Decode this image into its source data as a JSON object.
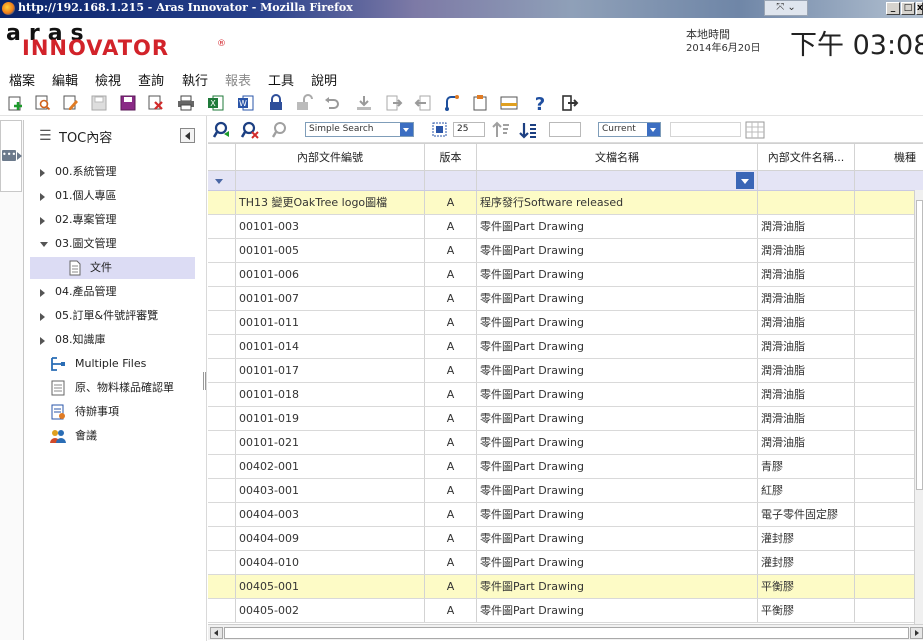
{
  "window": {
    "title": "http://192.168.1.215 - Aras Innovator - Mozilla Firefox"
  },
  "header": {
    "logo_top": "aras",
    "logo_bottom": "INNOVATOR",
    "logo_mark": "®",
    "time_label": "本地時間",
    "date": "2014年6月20日",
    "clock": "下午 03:08"
  },
  "menu": [
    "檔案",
    "編輯",
    "檢視",
    "查詢",
    "執行",
    "報表",
    "工具",
    "說明"
  ],
  "toc": {
    "title": "TOC內容",
    "items": [
      {
        "label": "00.系統管理",
        "state": "collapsed"
      },
      {
        "label": "01.個人專區",
        "state": "collapsed"
      },
      {
        "label": "02.專案管理",
        "state": "collapsed"
      },
      {
        "label": "03.圖文管理",
        "state": "expanded"
      },
      {
        "label": "文件",
        "state": "selected",
        "icon": "document-icon"
      },
      {
        "label": "04.產品管理",
        "state": "collapsed"
      },
      {
        "label": "05.訂單&件號評審覽",
        "state": "collapsed"
      },
      {
        "label": "08.知識庫",
        "state": "collapsed"
      },
      {
        "label": "Multiple Files",
        "icon": "multiple-files-icon"
      },
      {
        "label": "原、物料樣品確認單",
        "icon": "form-icon"
      },
      {
        "label": "待辦事項",
        "icon": "todo-icon"
      },
      {
        "label": "會議",
        "icon": "meeting-icon"
      }
    ]
  },
  "gridbar": {
    "search_mode": "Simple Search",
    "page_size": "25",
    "page_number": "",
    "version_filter": "Current",
    "extra_field": ""
  },
  "grid": {
    "columns": [
      "內部文件編號",
      "版本",
      "文檔名稱",
      "內部文件名稱...",
      "機種"
    ],
    "rows": [
      {
        "id": "TH13 變更OakTree logo圖檔",
        "rev": "A",
        "name": "程序發行Software released",
        "internal": "",
        "model": "",
        "highlight": true
      },
      {
        "id": "00101-003",
        "rev": "A",
        "name": "零件圖Part Drawing",
        "internal": "潤滑油脂",
        "model": ""
      },
      {
        "id": "00101-005",
        "rev": "A",
        "name": "零件圖Part Drawing",
        "internal": "潤滑油脂",
        "model": ""
      },
      {
        "id": "00101-006",
        "rev": "A",
        "name": "零件圖Part Drawing",
        "internal": "潤滑油脂",
        "model": ""
      },
      {
        "id": "00101-007",
        "rev": "A",
        "name": "零件圖Part Drawing",
        "internal": "潤滑油脂",
        "model": ""
      },
      {
        "id": "00101-011",
        "rev": "A",
        "name": "零件圖Part Drawing",
        "internal": "潤滑油脂",
        "model": ""
      },
      {
        "id": "00101-014",
        "rev": "A",
        "name": "零件圖Part Drawing",
        "internal": "潤滑油脂",
        "model": ""
      },
      {
        "id": "00101-017",
        "rev": "A",
        "name": "零件圖Part Drawing",
        "internal": "潤滑油脂",
        "model": ""
      },
      {
        "id": "00101-018",
        "rev": "A",
        "name": "零件圖Part Drawing",
        "internal": "潤滑油脂",
        "model": ""
      },
      {
        "id": "00101-019",
        "rev": "A",
        "name": "零件圖Part Drawing",
        "internal": "潤滑油脂",
        "model": ""
      },
      {
        "id": "00101-021",
        "rev": "A",
        "name": "零件圖Part Drawing",
        "internal": "潤滑油脂",
        "model": ""
      },
      {
        "id": "00402-001",
        "rev": "A",
        "name": "零件圖Part Drawing",
        "internal": "青膠",
        "model": ""
      },
      {
        "id": "00403-001",
        "rev": "A",
        "name": "零件圖Part Drawing",
        "internal": "紅膠",
        "model": ""
      },
      {
        "id": "00404-003",
        "rev": "A",
        "name": "零件圖Part Drawing",
        "internal": "電子零件固定膠",
        "model": ""
      },
      {
        "id": "00404-009",
        "rev": "A",
        "name": "零件圖Part Drawing",
        "internal": "灌封膠",
        "model": ""
      },
      {
        "id": "00404-010",
        "rev": "A",
        "name": "零件圖Part Drawing",
        "internal": "灌封膠",
        "model": ""
      },
      {
        "id": "00405-001",
        "rev": "A",
        "name": "零件圖Part Drawing",
        "internal": "平衡膠",
        "model": "",
        "highlight": true
      },
      {
        "id": "00405-002",
        "rev": "A",
        "name": "零件圖Part Drawing",
        "internal": "平衡膠",
        "model": ""
      }
    ]
  }
}
